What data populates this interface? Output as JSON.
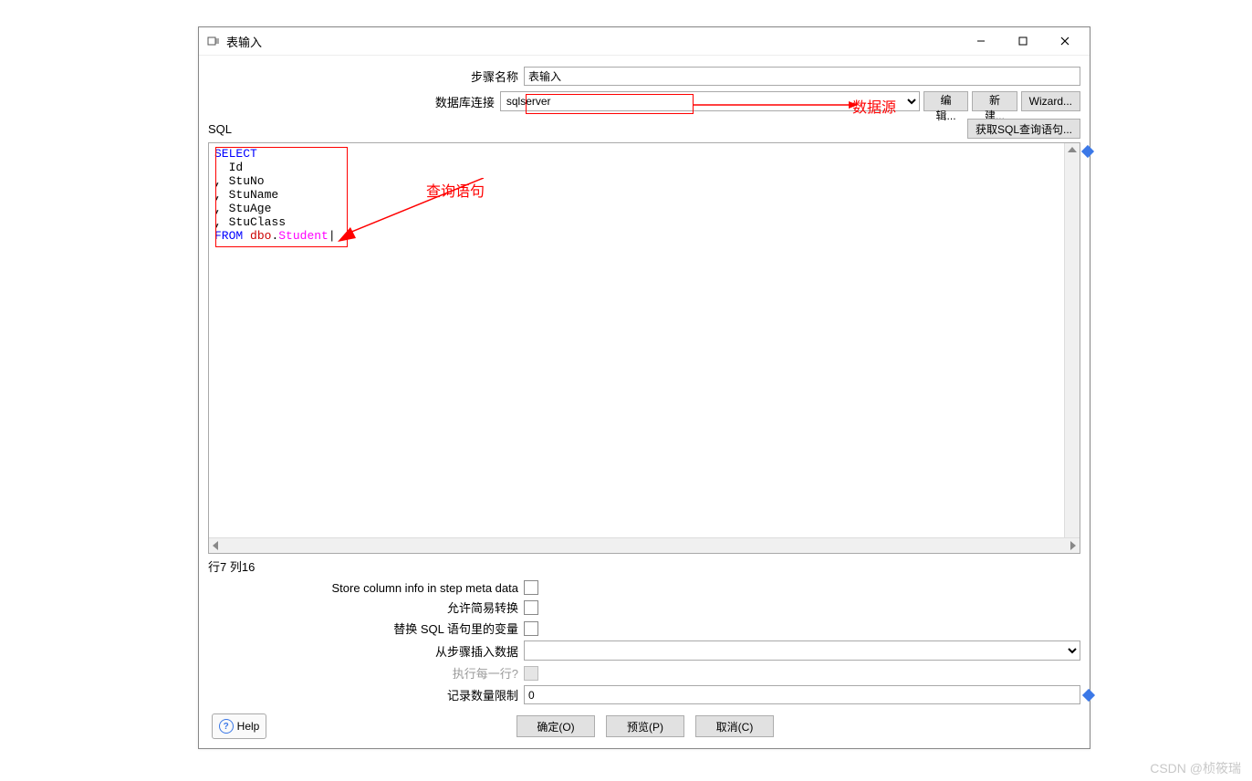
{
  "window": {
    "title": "表输入"
  },
  "labels": {
    "step_name": "步骤名称",
    "db_conn": "数据库连接",
    "sql": "SQL",
    "get_sql_stmt": "获取SQL查询语句...",
    "edit": "编辑...",
    "new": "新建...",
    "wizard": "Wizard...",
    "row_col": "行7 列16",
    "store_col_info": "Store column info in step meta data",
    "allow_lazy": "允许简易转换",
    "replace_vars": "替换 SQL 语句里的变量",
    "insert_from_step": "从步骤插入数据",
    "exec_each_row": "执行每一行?",
    "record_limit": "记录数量限制",
    "help": "Help",
    "ok": "确定(O)",
    "preview": "预览(P)",
    "cancel": "取消(C)"
  },
  "values": {
    "step_name": "表输入",
    "db_conn": "sqlserver",
    "record_limit": "0"
  },
  "sql": {
    "select": "SELECT",
    "cols": [
      "  Id",
      ", StuNo",
      ", StuName",
      ", StuAge",
      ", StuClass"
    ],
    "from": "FROM",
    "schema": "dbo",
    "table": "Student"
  },
  "annotations": {
    "datasource": "数据源",
    "querystmt": "查询语句"
  },
  "watermark": "CSDN @桢筱瑞"
}
